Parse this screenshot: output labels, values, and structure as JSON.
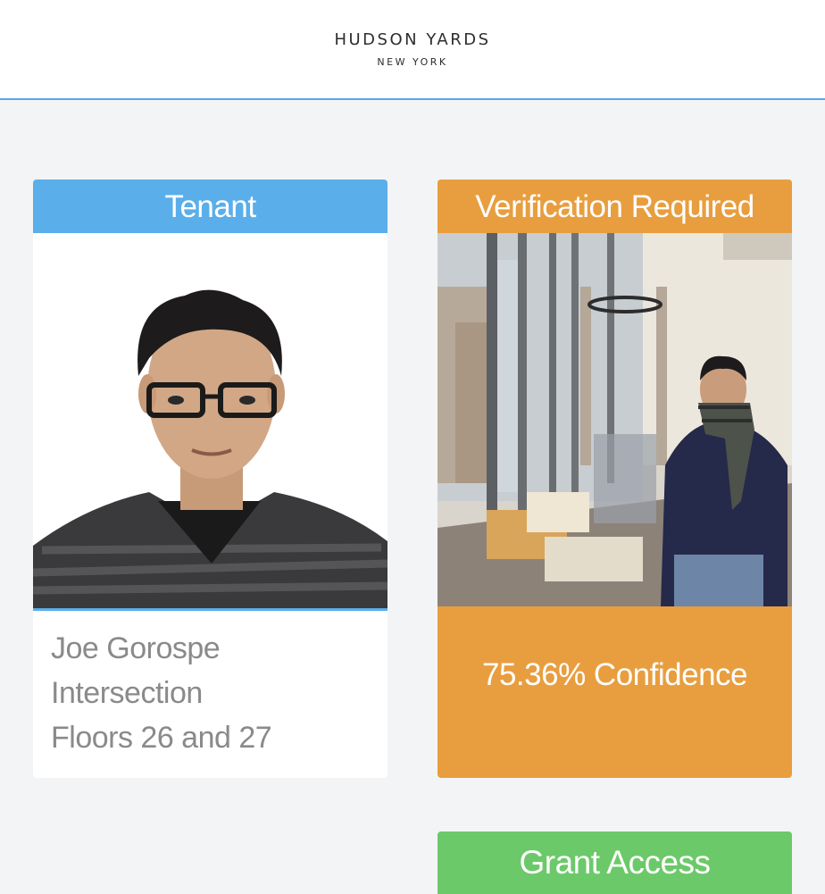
{
  "header": {
    "brand_title": "HUDSON YARDS",
    "brand_subtitle": "NEW YORK"
  },
  "tenant_card": {
    "title": "Tenant",
    "name": "Joe Gorospe",
    "company": "Intersection",
    "floors": "Floors 26 and 27"
  },
  "verification_card": {
    "title": "Verification Required",
    "confidence": "75.36% Confidence"
  },
  "actions": {
    "grant_label": "Grant Access"
  },
  "colors": {
    "tenant_accent": "#5aaeea",
    "verification_accent": "#e89e3f",
    "grant_accent": "#6cc96a"
  }
}
